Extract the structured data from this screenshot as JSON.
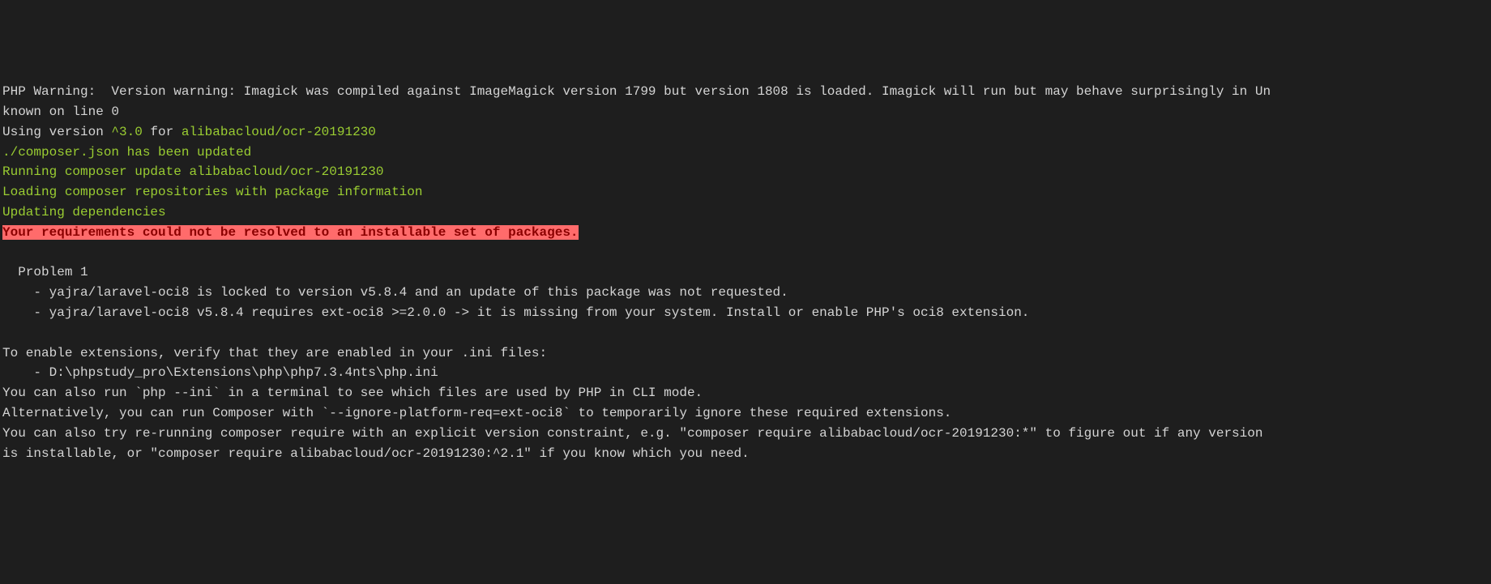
{
  "terminal": {
    "lines": [
      {
        "type": "plain",
        "text": "PHP Warning:  Version warning: Imagick was compiled against ImageMagick version 1799 but version 1808 is loaded. Imagick will run but may behave surprisingly in Un"
      },
      {
        "type": "plain",
        "text": "known on line 0"
      },
      {
        "type": "mixed",
        "parts": [
          {
            "style": "plain",
            "text": "Using version "
          },
          {
            "style": "green",
            "text": "^3.0"
          },
          {
            "style": "plain",
            "text": " for "
          },
          {
            "style": "green",
            "text": "alibabacloud/ocr-20191230"
          }
        ]
      },
      {
        "type": "green",
        "text": "./composer.json has been updated"
      },
      {
        "type": "green",
        "text": "Running composer update alibabacloud/ocr-20191230"
      },
      {
        "type": "green",
        "text": "Loading composer repositories with package information"
      },
      {
        "type": "green",
        "text": "Updating dependencies"
      },
      {
        "type": "error",
        "text": "Your requirements could not be resolved to an installable set of packages."
      },
      {
        "type": "blank"
      },
      {
        "type": "plain",
        "text": "  Problem 1"
      },
      {
        "type": "plain",
        "text": "    - yajra/laravel-oci8 is locked to version v5.8.4 and an update of this package was not requested."
      },
      {
        "type": "plain",
        "text": "    - yajra/laravel-oci8 v5.8.4 requires ext-oci8 >=2.0.0 -> it is missing from your system. Install or enable PHP's oci8 extension."
      },
      {
        "type": "blank"
      },
      {
        "type": "plain",
        "text": "To enable extensions, verify that they are enabled in your .ini files:"
      },
      {
        "type": "plain",
        "text": "    - D:\\phpstudy_pro\\Extensions\\php\\php7.3.4nts\\php.ini"
      },
      {
        "type": "plain",
        "text": "You can also run `php --ini` in a terminal to see which files are used by PHP in CLI mode."
      },
      {
        "type": "plain",
        "text": "Alternatively, you can run Composer with `--ignore-platform-req=ext-oci8` to temporarily ignore these required extensions."
      },
      {
        "type": "plain",
        "text": "You can also try re-running composer require with an explicit version constraint, e.g. \"composer require alibabacloud/ocr-20191230:*\" to figure out if any version"
      },
      {
        "type": "plain",
        "text": "is installable, or \"composer require alibabacloud/ocr-20191230:^2.1\" if you know which you need."
      },
      {
        "type": "blank"
      }
    ]
  }
}
